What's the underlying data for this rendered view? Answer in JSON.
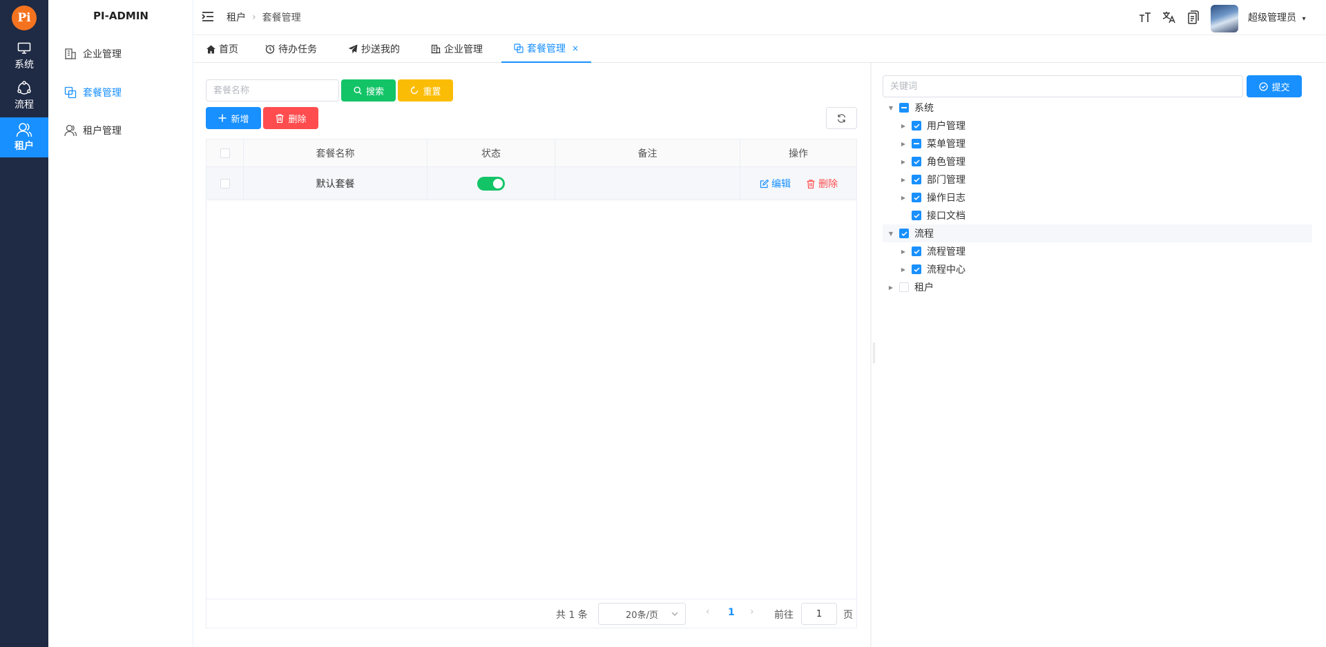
{
  "rail": {
    "logo": "Pi",
    "items": [
      {
        "label": "系统",
        "icon": "monitor-icon"
      },
      {
        "label": "流程",
        "icon": "flow-icon"
      },
      {
        "label": "租户",
        "icon": "users-icon"
      }
    ]
  },
  "sidebar": {
    "title": "PI-ADMIN",
    "items": [
      {
        "label": "企业管理",
        "icon": "building-icon"
      },
      {
        "label": "套餐管理",
        "icon": "package-icon"
      },
      {
        "label": "租户管理",
        "icon": "user-icon"
      }
    ]
  },
  "header": {
    "breadcrumb": [
      "租户",
      "套餐管理"
    ],
    "user": "超级管理员"
  },
  "tabs": [
    {
      "label": "首页",
      "icon": "home-icon"
    },
    {
      "label": "待办任务",
      "icon": "clock-icon"
    },
    {
      "label": "抄送我的",
      "icon": "send-icon"
    },
    {
      "label": "企业管理",
      "icon": "building-icon"
    },
    {
      "label": "套餐管理",
      "icon": "package-icon",
      "close": "×"
    }
  ],
  "filter": {
    "placeholder": "套餐名称",
    "search_label": "搜索",
    "reset_label": "重置"
  },
  "toolbar": {
    "add_label": "新增",
    "delete_label": "删除"
  },
  "table": {
    "columns": [
      "套餐名称",
      "状态",
      "备注",
      "操作"
    ],
    "rows": [
      {
        "name": "默认套餐",
        "status": true,
        "remark": "",
        "edit": "编辑",
        "delete": "删除"
      }
    ]
  },
  "pagination": {
    "total": "共 1 条",
    "page_size": "20条/页",
    "current": "1",
    "goto_label": "前往",
    "goto_value": "1",
    "page_word": "页"
  },
  "tree_panel": {
    "placeholder": "关键词",
    "submit_label": "提交",
    "nodes": [
      {
        "label": "系统",
        "level": 0,
        "state": "indeterminate",
        "expanded": true
      },
      {
        "label": "用户管理",
        "level": 1,
        "state": "checked",
        "expanded": false
      },
      {
        "label": "菜单管理",
        "level": 1,
        "state": "indeterminate",
        "expanded": false
      },
      {
        "label": "角色管理",
        "level": 1,
        "state": "checked",
        "expanded": false
      },
      {
        "label": "部门管理",
        "level": 1,
        "state": "checked",
        "expanded": false
      },
      {
        "label": "操作日志",
        "level": 1,
        "state": "checked",
        "expanded": false
      },
      {
        "label": "接口文档",
        "level": 1,
        "state": "checked",
        "leaf": true
      },
      {
        "label": "流程",
        "level": 0,
        "state": "checked",
        "expanded": true
      },
      {
        "label": "流程管理",
        "level": 1,
        "state": "checked",
        "expanded": false
      },
      {
        "label": "流程中心",
        "level": 1,
        "state": "checked",
        "expanded": false
      },
      {
        "label": "租户",
        "level": 0,
        "state": "empty",
        "expanded": false
      }
    ]
  },
  "colors": {
    "rail_bg": "#1f2a44",
    "primary": "#1890ff",
    "success": "#13c467",
    "warning": "#fbbc05",
    "danger": "#ff4d4f",
    "logo": "#f5731f"
  }
}
